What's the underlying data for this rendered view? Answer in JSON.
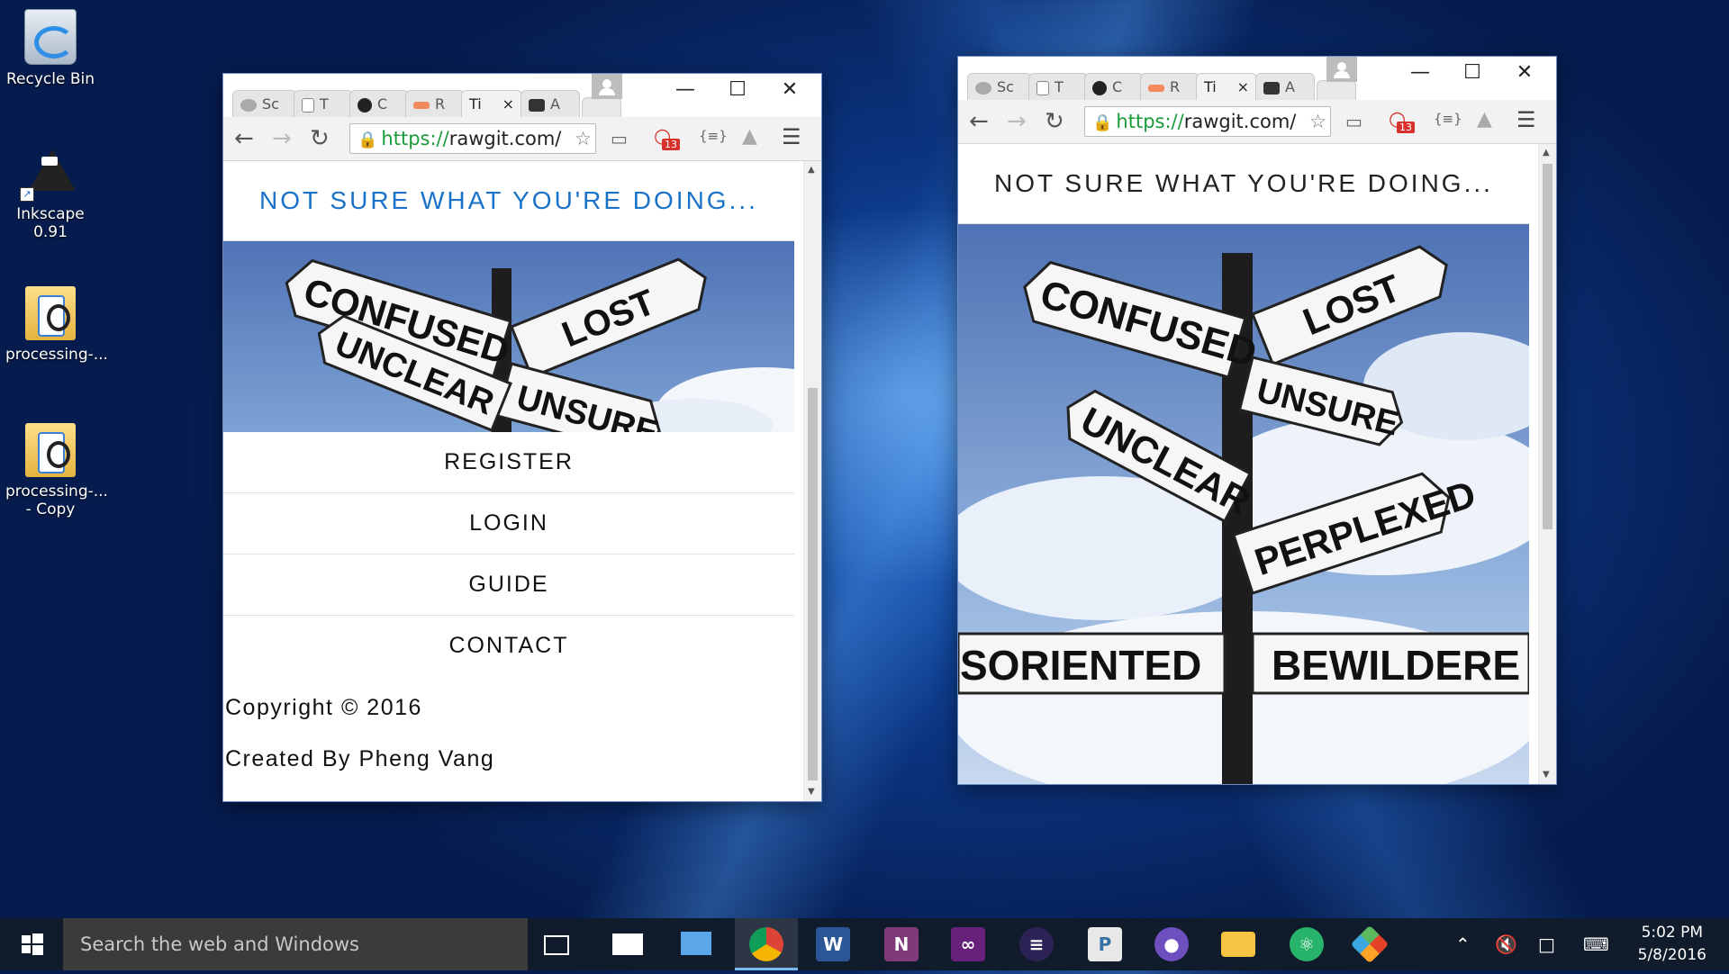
{
  "desktop": {
    "icons": [
      {
        "label": "Recycle Bin"
      },
      {
        "label": "Inkscape 0.91"
      },
      {
        "label": "processing-..."
      },
      {
        "label_line1": "processing-...",
        "label_line2": "- Copy"
      }
    ]
  },
  "window_left": {
    "tabs": [
      "Sc",
      "T",
      "C",
      "R",
      "Ti",
      "A"
    ],
    "tab_close": "×",
    "url_scheme": "https://",
    "url_rest": "rawgit.com/",
    "ext_badge": "13",
    "ext_json": "{≡}",
    "page": {
      "title": "NOT SURE WHAT YOU'RE DOING...",
      "title_color": "#1a72c9",
      "menu": [
        "REGISTER",
        "LOGIN",
        "GUIDE",
        "CONTACT"
      ],
      "copyright": "Copyright © 2016",
      "created_by": "Created By Pheng Vang"
    }
  },
  "window_right": {
    "tabs": [
      "Sc",
      "T",
      "C",
      "R",
      "Ti",
      "A"
    ],
    "tab_close": "×",
    "url_scheme": "https://",
    "url_rest": "rawgit.com/",
    "ext_badge": "13",
    "ext_json": "{≡}",
    "page": {
      "title": "NOT SURE WHAT YOU'RE DOING...",
      "title_color": "#222222"
    }
  },
  "signpost": {
    "signs": [
      "LOST",
      "CONFUSED",
      "UNSURE",
      "UNCLEAR",
      "PERPLEXED",
      "SORIENTED",
      "BEWILDERE"
    ]
  },
  "taskbar": {
    "search_placeholder": "Search the web and Windows",
    "time": "5:02 PM",
    "date": "5/8/2016"
  }
}
